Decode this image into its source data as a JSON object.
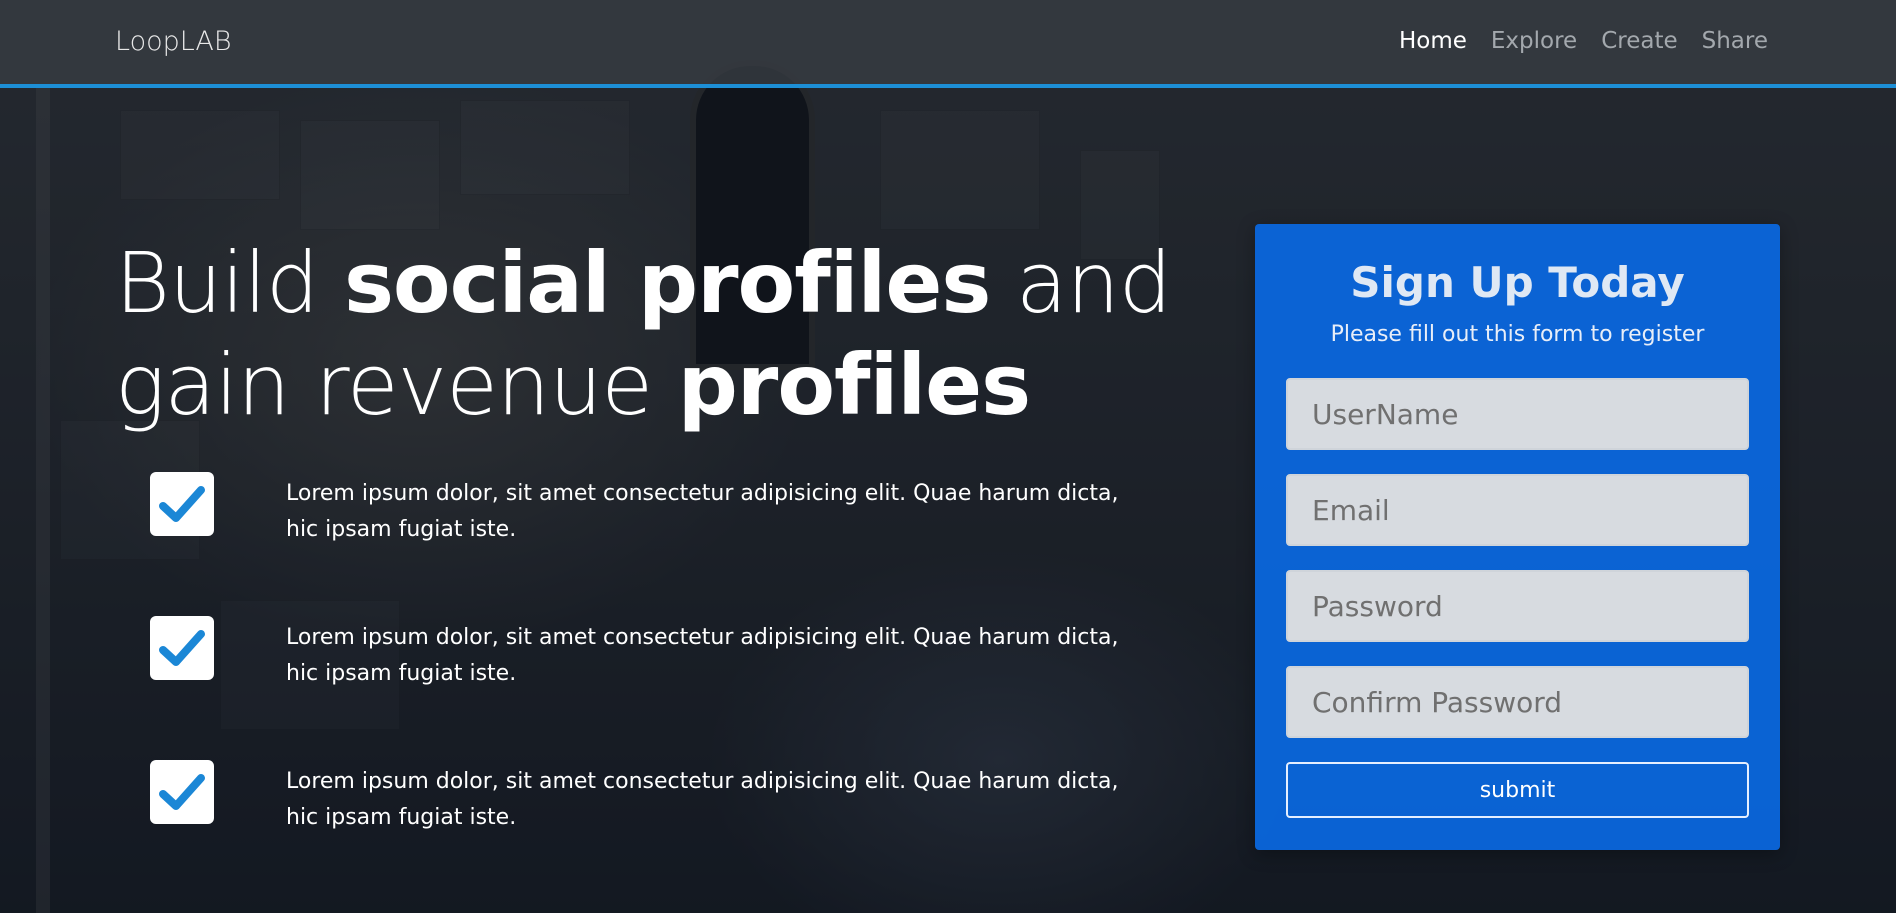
{
  "navbar": {
    "brand": "LoopLAB",
    "links": [
      {
        "label": "Home"
      },
      {
        "label": "Explore"
      },
      {
        "label": "Create"
      },
      {
        "label": "Share"
      }
    ]
  },
  "hero": {
    "title_parts": [
      "Build ",
      "social profiles",
      " and gain revenue ",
      "profiles"
    ],
    "features": [
      {
        "text": "Lorem ipsum dolor, sit amet consectetur adipisicing elit. Quae harum dicta, hic ipsam fugiat iste."
      },
      {
        "text": "Lorem ipsum dolor, sit amet consectetur adipisicing elit. Quae harum dicta, hic ipsam fugiat iste."
      },
      {
        "text": "Lorem ipsum dolor, sit amet consectetur adipisicing elit. Quae harum dicta, hic ipsam fugiat iste."
      }
    ],
    "check_icon": "check-icon",
    "check_color": "#1b87d6"
  },
  "signup": {
    "title": "Sign Up Today",
    "subtitle": "Please fill out this form to register",
    "username_placeholder": "UserName",
    "email_placeholder": "Email",
    "password_placeholder": "Password",
    "confirm_placeholder": "Confirm Password",
    "submit_label": "submit",
    "card_color": "#0a68e1"
  },
  "theme": {
    "accent": "#1d8fd6"
  }
}
